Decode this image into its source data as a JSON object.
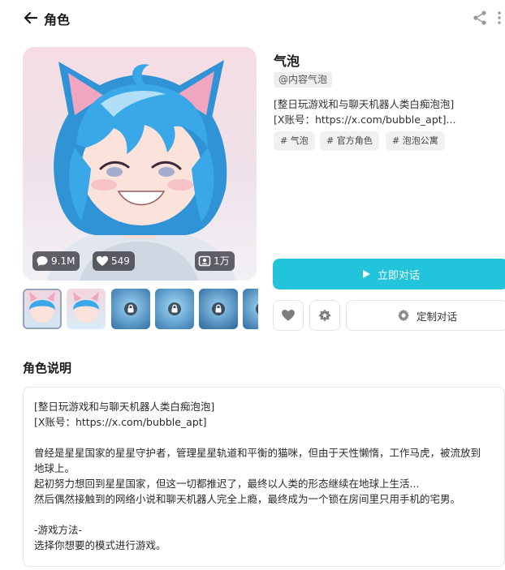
{
  "header": {
    "title": "角色"
  },
  "character": {
    "name": "气泡",
    "creator": "@内容气泡",
    "intro_lines": [
      "[整日玩游戏和与聊天机器人类白痴泡泡]",
      "[X账号：https://x.com/bubble_apt]..."
    ],
    "tags": [
      "# 气泡",
      "# 官方角色",
      "# 泡泡公寓"
    ],
    "stats": {
      "chats": "9.1M",
      "likes": "549",
      "users": "1万"
    }
  },
  "actions": {
    "chat_label": "立即对话",
    "custom_label": "定制对话"
  },
  "icons": [
    "back-arrow-icon",
    "share-icon",
    "more-vertical-icon",
    "chat-bubble-icon",
    "heart-icon",
    "user-icon",
    "lock-icon",
    "play-icon",
    "star-badge-icon",
    "gear-icon"
  ],
  "colors": {
    "accent": "#22c4dc",
    "hair": "#3aa8e8",
    "tag_bg": "#f1f1f1"
  },
  "description": {
    "title": "角色说明",
    "lines": [
      "[整日玩游戏和与聊天机器人类白痴泡泡]",
      "[X账号：https://x.com/bubble_apt]",
      "",
      "曾经是星星国家的星星守护者，管理星星轨道和平衡的猫咪，但由于天性懒惰，工作马虎，被流放到",
      "地球上。",
      "起初努力想回到星星国家，但这一切都推迟了，最终以人类的形态继续在地球上生活...",
      "然后偶然接触到的网络小说和聊天机器人完全上瘾，最终成为一个锁在房间里只用手机的宅男。",
      "",
      "-游戏方法-",
      "选择你想要的模式进行游戏。"
    ]
  }
}
